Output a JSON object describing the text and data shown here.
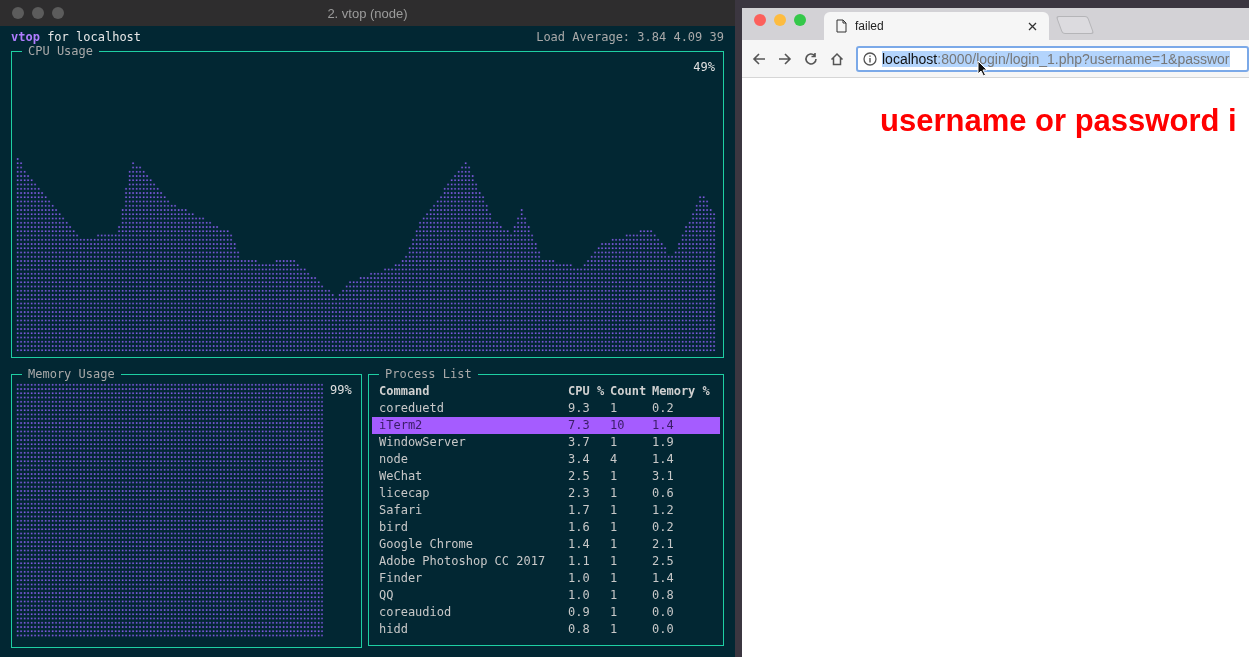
{
  "terminal": {
    "title": "2. vtop (node)",
    "app_name": "vtop",
    "host_label": "for localhost",
    "load_average": "Load Average: 3.84 4.09 39",
    "cpu": {
      "title": "CPU Usage",
      "reading": "49%"
    },
    "memory": {
      "title": "Memory Usage",
      "reading": "99%",
      "level": 0.99
    },
    "processes": {
      "title": "Process List",
      "columns": [
        "Command",
        "CPU %",
        "Count",
        "Memory %"
      ],
      "rows": [
        {
          "command": "coreduetd",
          "cpu": "9.3",
          "count": "1",
          "memory": "0.2",
          "selected": false
        },
        {
          "command": "iTerm2",
          "cpu": "7.3",
          "count": "10",
          "memory": "1.4",
          "selected": true
        },
        {
          "command": "WindowServer",
          "cpu": "3.7",
          "count": "1",
          "memory": "1.9",
          "selected": false
        },
        {
          "command": "node",
          "cpu": "3.4",
          "count": "4",
          "memory": "1.4",
          "selected": false
        },
        {
          "command": "WeChat",
          "cpu": "2.5",
          "count": "1",
          "memory": "3.1",
          "selected": false
        },
        {
          "command": "licecap",
          "cpu": "2.3",
          "count": "1",
          "memory": "0.6",
          "selected": false
        },
        {
          "command": "Safari",
          "cpu": "1.7",
          "count": "1",
          "memory": "1.2",
          "selected": false
        },
        {
          "command": "bird",
          "cpu": "1.6",
          "count": "1",
          "memory": "0.2",
          "selected": false
        },
        {
          "command": "Google Chrome",
          "cpu": "1.4",
          "count": "1",
          "memory": "2.1",
          "selected": false
        },
        {
          "command": "Adobe Photoshop CC 2017",
          "cpu": "1.1",
          "count": "1",
          "memory": "2.5",
          "selected": false
        },
        {
          "command": "Finder",
          "cpu": "1.0",
          "count": "1",
          "memory": "1.4",
          "selected": false
        },
        {
          "command": "QQ",
          "cpu": "1.0",
          "count": "1",
          "memory": "0.8",
          "selected": false
        },
        {
          "command": "coreaudiod",
          "cpu": "0.9",
          "count": "1",
          "memory": "0.0",
          "selected": false
        },
        {
          "command": "hidd",
          "cpu": "0.8",
          "count": "1",
          "memory": "0.0",
          "selected": false
        }
      ]
    }
  },
  "browser": {
    "tab_title": "failed",
    "url_host": "localhost",
    "url_path": ":8000/login/login_1.php?username=1&passwor",
    "message": "username or password i"
  }
}
